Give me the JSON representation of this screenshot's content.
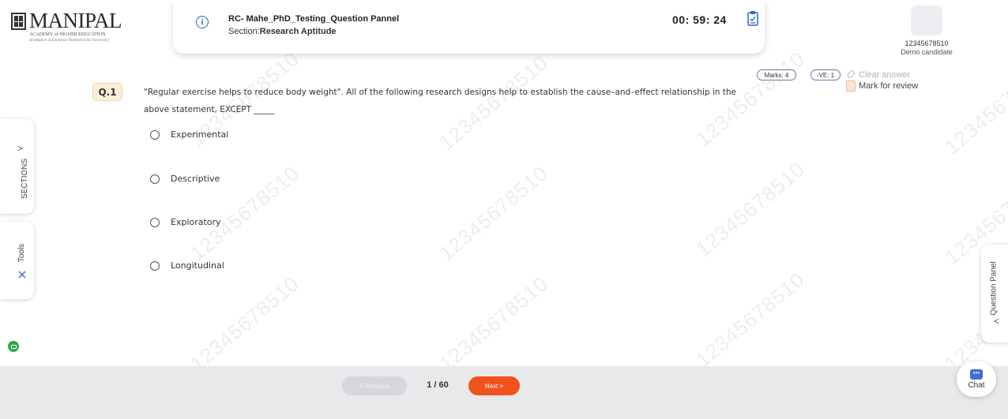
{
  "header": {
    "logo_main": "MANIPAL",
    "logo_sub": "ACADEMY of HIGHER EDUCATION",
    "logo_sub2": "(Institution of Eminence Deemed to be University)",
    "test_name": "RC- Mahe_PhD_Testing_Question Pannel",
    "section_prefix": "Section:",
    "section_name": "Research Aptitude",
    "timer": "00: 59: 24",
    "candidate_id": "12345678510",
    "candidate_name": "Demo candidate"
  },
  "question": {
    "number": "Q.1",
    "text": "\"Regular exercise helps to reduce body weight\". All of the following research designs help to establish the cause–and–effect relationship in the above statement, EXCEPT _____",
    "marks": "Marks: 4",
    "negative": "-VE: 1",
    "clear_answer": "Clear answer",
    "mark_for_review": "Mark for review",
    "options": [
      {
        "label": "Experimental"
      },
      {
        "label": "Descriptive"
      },
      {
        "label": "Exploratory"
      },
      {
        "label": "Longitudinal"
      }
    ]
  },
  "side": {
    "sections_label": "SECTIONS",
    "tools_label": "Tools",
    "question_panel_label": "Question Panel",
    "sections_chevron": ">",
    "panel_chevron": "<"
  },
  "footer": {
    "previous_label": "< Previous",
    "pager": "1 / 60",
    "next_label": "Next >",
    "chat_label": "Chat",
    "chat_icon_text": "•••"
  },
  "watermark": "12345678510",
  "colors": {
    "accent": "#f0521c",
    "info": "#2b67c9",
    "camera": "#2fa750",
    "chat": "#3f6fd6"
  }
}
